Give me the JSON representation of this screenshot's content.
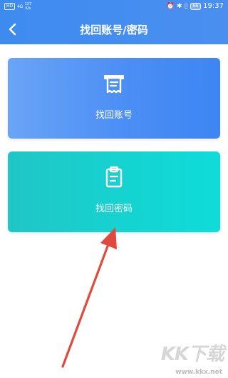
{
  "status_bar": {
    "hd_badge": "HD",
    "signal": "4G",
    "speed_value": "127",
    "speed_unit": "K/s",
    "battery": "66",
    "time": "19:37"
  },
  "header": {
    "title": "找回账号/密码",
    "back_icon": "chevron-left-icon"
  },
  "options": [
    {
      "label": "找回账号",
      "icon": "receipt-icon",
      "colors": {
        "start": "#6aa4f6",
        "end": "#3d86f3"
      }
    },
    {
      "label": "找回密码",
      "icon": "clipboard-icon",
      "colors": {
        "start": "#21c6c6",
        "end": "#0fdcda"
      }
    }
  ],
  "annotation": {
    "arrow_color": "#e1493f"
  },
  "watermark": {
    "logo": "KK下载",
    "url": "www.kkx.net"
  },
  "colors": {
    "header_bg": "#4a8ff0",
    "page_bg": "#ffffff"
  }
}
